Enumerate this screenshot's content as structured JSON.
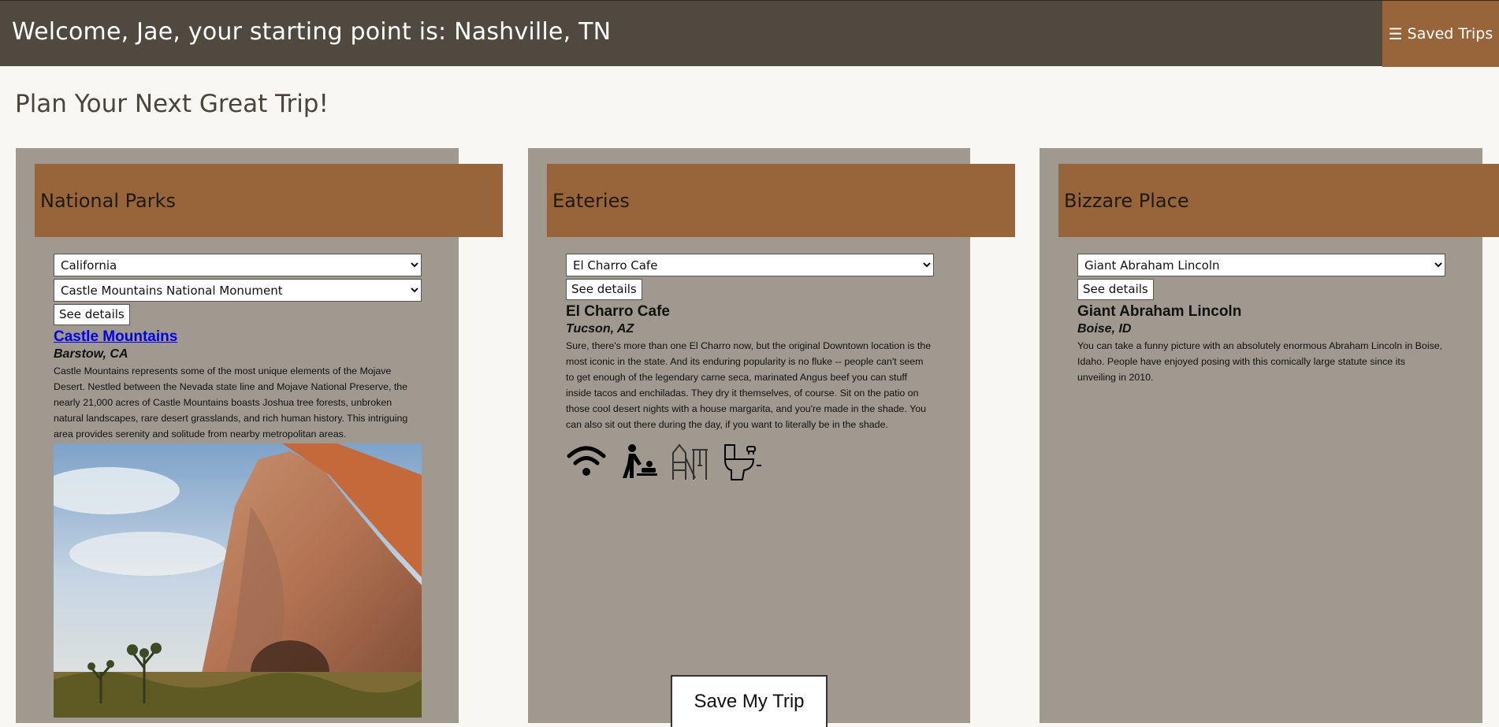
{
  "header": {
    "welcome": "Welcome, Jae, your starting point is: Nashville, TN",
    "saved_trips_icon": "☰",
    "saved_trips_label": "Saved Trips"
  },
  "page_title": "Plan Your Next Great Trip!",
  "parks": {
    "heading": "National Parks",
    "state_select": "California",
    "park_select": "Castle Mountains National Monument",
    "details_label": "See details",
    "title": "Castle Mountains",
    "location": "Barstow, CA",
    "description": "Castle Mountains represents some of the most unique elements of the Mojave Desert. Nestled between the Nevada state line and Mojave National Preserve, the nearly 21,000 acres of Castle Mountains boasts Joshua tree forests, unbroken natural landscapes, rare desert grasslands, and rich human history. This intriguing area provides serenity and solitude from nearby metropolitan areas."
  },
  "eateries": {
    "heading": "Eateries",
    "select": "El Charro Cafe",
    "details_label": "See details",
    "title": "El Charro Cafe",
    "location": "Tucson, AZ",
    "description": "Sure, there's more than one El Charro now, but the original Downtown location is the most iconic in the state. And its enduring popularity is no fluke -- people can't seem to get enough of the legendary carne seca, marinated Angus beef you can stuff inside tacos and enchiladas. They dry it themselves, of course. Sit on the patio on those cool desert nights with a house margarita, and you're made in the shade. You can also sit out there during the day, if you want to literally be in the shade.",
    "amenities": [
      "wifi-icon",
      "baby-changing-icon",
      "playground-icon",
      "restroom-icon"
    ]
  },
  "bizarre": {
    "heading": "Bizzare Place",
    "select": "Giant Abraham Lincoln",
    "details_label": "See details",
    "title": "Giant Abraham Lincoln",
    "location": "Boise, ID",
    "description": "You can take a funny picture with an absolutely enormous Abraham Lincoln in Boise, Idaho. People have enjoyed posing with this comically large statute since its unveiling in 2010."
  },
  "save_label": "Save My Trip",
  "colors": {
    "topbar": "#4f493f",
    "accent": "#98653a",
    "card": "#a09990",
    "page": "#f8f7f3"
  }
}
